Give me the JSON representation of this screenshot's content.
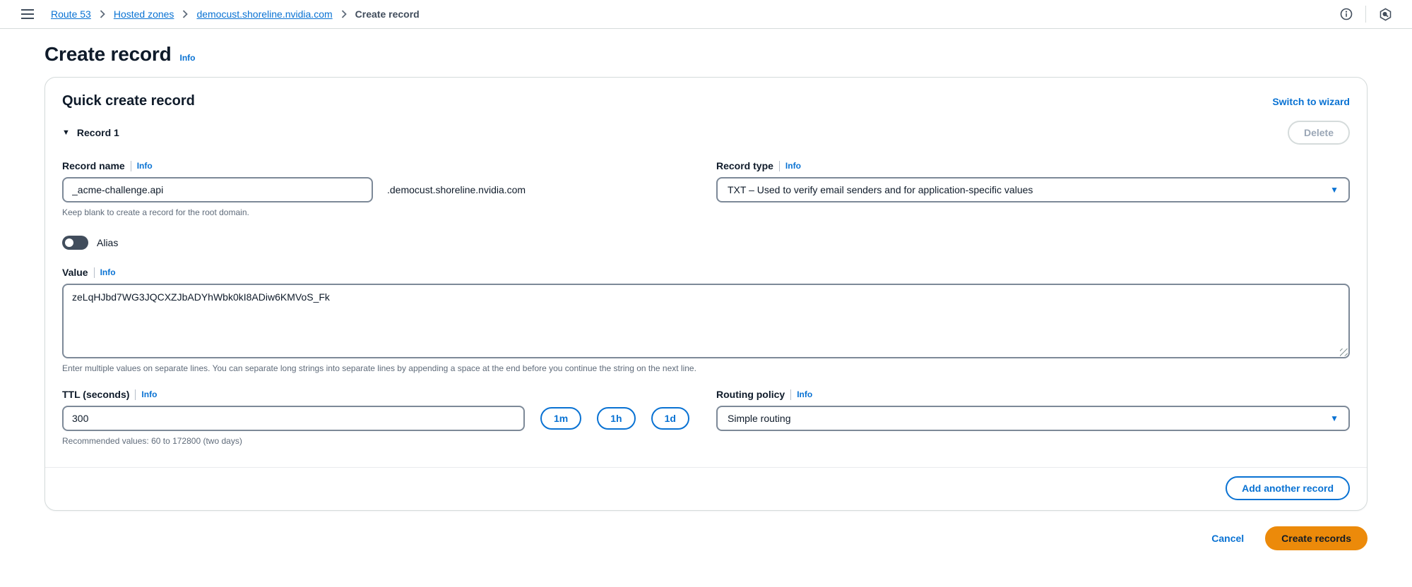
{
  "topbar": {
    "breadcrumbs": [
      {
        "label": "Route 53"
      },
      {
        "label": "Hosted zones"
      },
      {
        "label": "democust.shoreline.nvidia.com"
      },
      {
        "label": "Create record"
      }
    ]
  },
  "page": {
    "title": "Create record",
    "info_label": "Info"
  },
  "card": {
    "title": "Quick create record",
    "switch_to_wizard_label": "Switch to wizard",
    "record_header": "Record 1",
    "delete_label": "Delete",
    "record_name": {
      "label": "Record name",
      "info_label": "Info",
      "value": "_acme-challenge.api",
      "suffix": ".democust.shoreline.nvidia.com",
      "help": "Keep blank to create a record for the root domain."
    },
    "record_type": {
      "label": "Record type",
      "info_label": "Info",
      "selected": "TXT – Used to verify email senders and for application-specific values"
    },
    "alias": {
      "label": "Alias",
      "state": "off"
    },
    "value": {
      "label": "Value",
      "info_label": "Info",
      "text": "zeLqHJbd7WG3JQCXZJbADYhWbk0kI8ADiw6KMVoS_Fk",
      "help": "Enter multiple values on separate lines. You can separate long strings into separate lines by appending a space at the end before you continue the string on the next line."
    },
    "ttl": {
      "label": "TTL (seconds)",
      "info_label": "Info",
      "value": "300",
      "presets": [
        "1m",
        "1h",
        "1d"
      ],
      "help": "Recommended values: 60 to 172800 (two days)"
    },
    "routing_policy": {
      "label": "Routing policy",
      "info_label": "Info",
      "selected": "Simple routing"
    },
    "add_record_label": "Add another record"
  },
  "actions": {
    "cancel_label": "Cancel",
    "submit_label": "Create records"
  },
  "colors": {
    "accent_blue": "#0972d3",
    "primary_button_bg": "#ec8a0a",
    "primary_button_text": "#131b25",
    "input_border": "#7d8998"
  }
}
